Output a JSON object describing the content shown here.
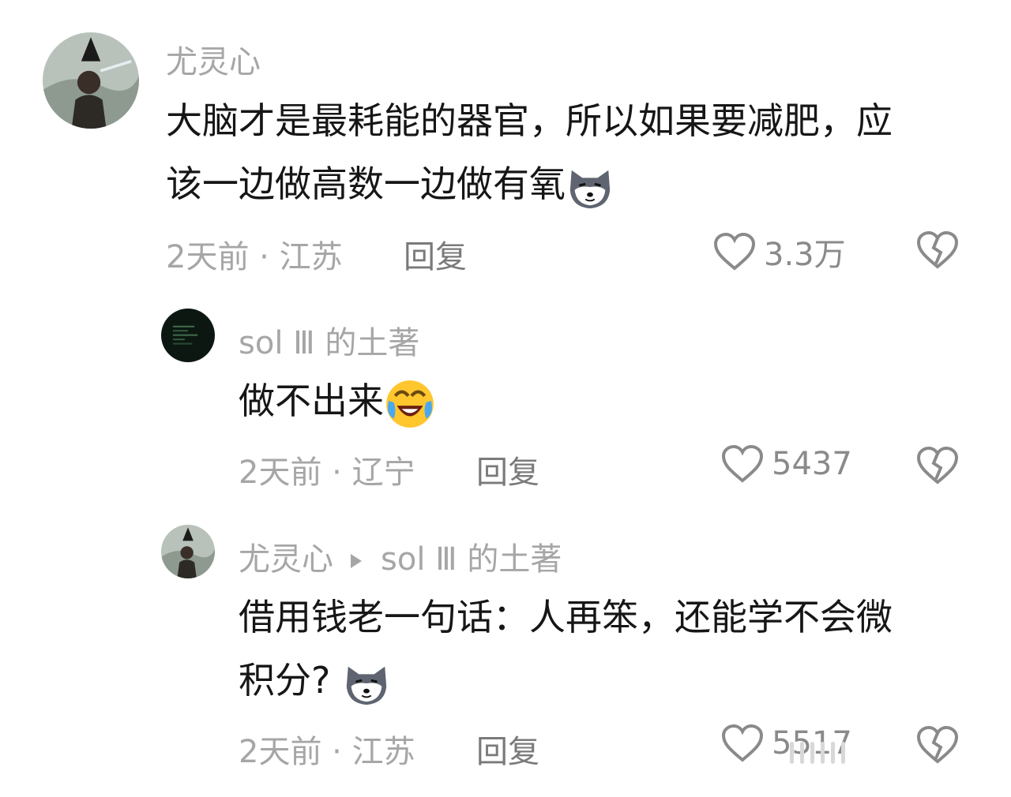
{
  "comments": [
    {
      "username": "尤灵心",
      "text_line1": "大脑才是最耗能的器官，所以如果要减肥，应",
      "text_line2": "该一边做高数一边做有氧",
      "emoji": "husky-face-emoji",
      "time": "2天前 · 江苏",
      "reply_label": "回复",
      "likes": "3.3万"
    },
    {
      "username": "sol Ⅲ 的土著",
      "text_line1": "做不出来",
      "emoji": "laughing-crying-emoji",
      "time": "2天前 · 辽宁",
      "reply_label": "回复",
      "likes": "5437"
    },
    {
      "username": "尤灵心",
      "reply_to": "sol Ⅲ 的土著",
      "text_line1": "借用钱老一句话：人再笨，还能学不会微",
      "text_line2": "积分?",
      "emoji": "husky-face-emoji",
      "time": "2天前 · 江苏",
      "reply_label": "回复",
      "likes": "5517"
    }
  ],
  "icons": {
    "like": "heart-outline-icon",
    "dislike": "broken-heart-icon"
  },
  "colors": {
    "text": "#161616",
    "muted": "#a6a6a6",
    "reply": "#7a7a7a"
  }
}
